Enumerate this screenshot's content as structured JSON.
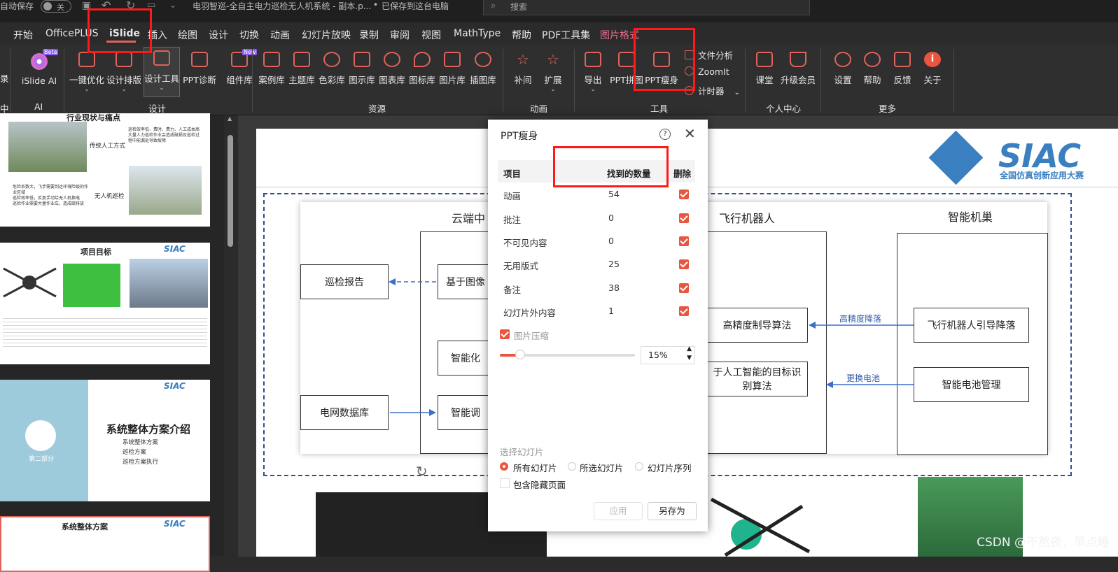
{
  "titlebar": {
    "autosave_label": "自动保存",
    "autosave_state": "关",
    "document_title": "电羽智巡-全自主电力巡检无人机系统 - 副本.p...",
    "save_status": "已保存到这台电脑",
    "search_placeholder": "搜索"
  },
  "tabs": [
    "开始",
    "OfficePLUS",
    "iSlide",
    "插入",
    "绘图",
    "设计",
    "切换",
    "动画",
    "幻灯片放映",
    "录制",
    "审阅",
    "视图",
    "MathType",
    "帮助",
    "PDF工具集",
    "图片格式"
  ],
  "ribbon": {
    "islide_ai": "iSlide AI",
    "beta": "Beta",
    "new_badge": "New",
    "design_buttons": [
      "一键优化",
      "设计排版",
      "设计工具",
      "PPT诊断",
      "组件库"
    ],
    "resource_buttons": [
      "案例库",
      "主题库",
      "色彩库",
      "图示库",
      "图表库",
      "图标库",
      "图片库",
      "插图库"
    ],
    "animation_buttons": [
      "补间",
      "扩展"
    ],
    "tool_buttons": [
      "导出",
      "PPT拼图",
      "PPT瘦身"
    ],
    "tool_small": [
      "文件分析",
      "ZoomIt",
      "计时器"
    ],
    "personal_buttons": [
      "课堂",
      "升级会员"
    ],
    "more_buttons": [
      "设置",
      "帮助",
      "反馈",
      "关于"
    ],
    "groups": {
      "ai": "AI",
      "design": "设计",
      "resources": "资源",
      "animation": "动画",
      "tools": "工具",
      "personal": "个人中心",
      "more": "更多"
    },
    "left_cut_top": "录",
    "left_cut_bottom": "中"
  },
  "thumbs": {
    "slide1_title": "行业现状与痛点",
    "slide1_label_a": "传统人工方式",
    "slide1_label_b": "无人机巡检",
    "slide1_bullets_a": [
      "巡检效率低、费时、费力、人工成本高",
      "大量人力巡检作业会造成破损及巡检过程中能漏处导致故障"
    ],
    "slide1_bullets_b": [
      "危险系数大，飞手需要到达环境险峻的作业区域",
      "巡检效率低，反复手动给无人机换电",
      "巡检作业需要大量作业车，造成碳排放"
    ],
    "slide2_title": "项目目标",
    "slide3_title": "系统整体方案介绍",
    "slide3_part": "第二部分",
    "slide3_items": [
      "系统整体方案",
      "巡检方案",
      "巡检方案执行"
    ],
    "slide4_title": "系统整体方案",
    "logo": "SIAC"
  },
  "slide": {
    "logo": "SIAC",
    "logo_sub": "全国仿真创新应用大赛",
    "col_cloud": "云端中",
    "col_drone": "飞行机器人",
    "col_nest": "智能机巢",
    "box_report": "巡检报告",
    "box_image": "基于图像",
    "box_smart1": "智能化",
    "box_smart2": "智能调",
    "box_grid": "电网数据库",
    "box_precise": "高精度制导算法",
    "box_ai": "于人工智能的目标识别算法",
    "box_guide": "飞行机器人引导降落",
    "box_battery": "智能电池管理",
    "arrow_land": "高精度降落",
    "arrow_battery": "更换电池"
  },
  "dialog": {
    "title": "PPT瘦身",
    "col_item": "项目",
    "col_count": "找到的数量",
    "col_delete": "删除",
    "rows": [
      {
        "item": "动画",
        "count": "54"
      },
      {
        "item": "批注",
        "count": "0"
      },
      {
        "item": "不可见内容",
        "count": "0"
      },
      {
        "item": "无用版式",
        "count": "25"
      },
      {
        "item": "备注",
        "count": "38"
      },
      {
        "item": "幻灯片外内容",
        "count": "1"
      }
    ],
    "compress_label": "图片压缩",
    "compress_value": "15%",
    "compress_fraction": 0.15,
    "select_label": "选择幻灯片",
    "radio_all": "所有幻灯片",
    "radio_selected": "所选幻灯片",
    "radio_sequence": "幻灯片序列",
    "include_hidden": "包含隐藏页面",
    "apply": "应用",
    "save_as": "另存为"
  },
  "watermark": "CSDN @不熬夜，早点睡",
  "colors": {
    "accent": "#e9553f",
    "highlight": "#ff1a1a",
    "slide_blue": "#2f5aa8",
    "logo_blue": "#3a7fbf"
  }
}
